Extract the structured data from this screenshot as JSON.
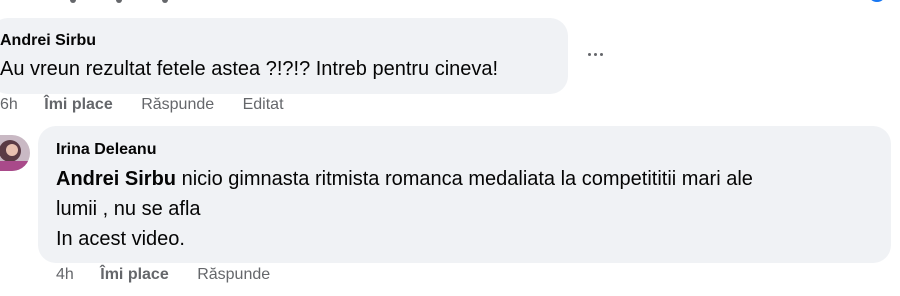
{
  "comments": [
    {
      "author": "Andrei Sirbu",
      "text": "Au vreun rezultat fetele astea ?!?!? Intreb pentru cineva!",
      "time": "6h",
      "like_label": "Îmi place",
      "reply_label": "Răspunde",
      "edited_label": "Editat"
    },
    {
      "author": "Irina Deleanu",
      "mention": "Andrei Sirbu",
      "text_line1_rest": " nicio gimnasta ritmista romanca medaliata la competititii mari ale",
      "text_line2": "lumii , nu se afla",
      "text_line3": "In acest video.",
      "time": "4h",
      "like_label": "Îmi place",
      "reply_label": "Răspunde"
    }
  ],
  "icons": {
    "more": "more-horizontal-icon",
    "avatar": "profile-avatar"
  },
  "colors": {
    "bubble": "#f0f2f5",
    "text": "#050505",
    "secondary": "#65676b",
    "reaction": "#1877f2"
  }
}
